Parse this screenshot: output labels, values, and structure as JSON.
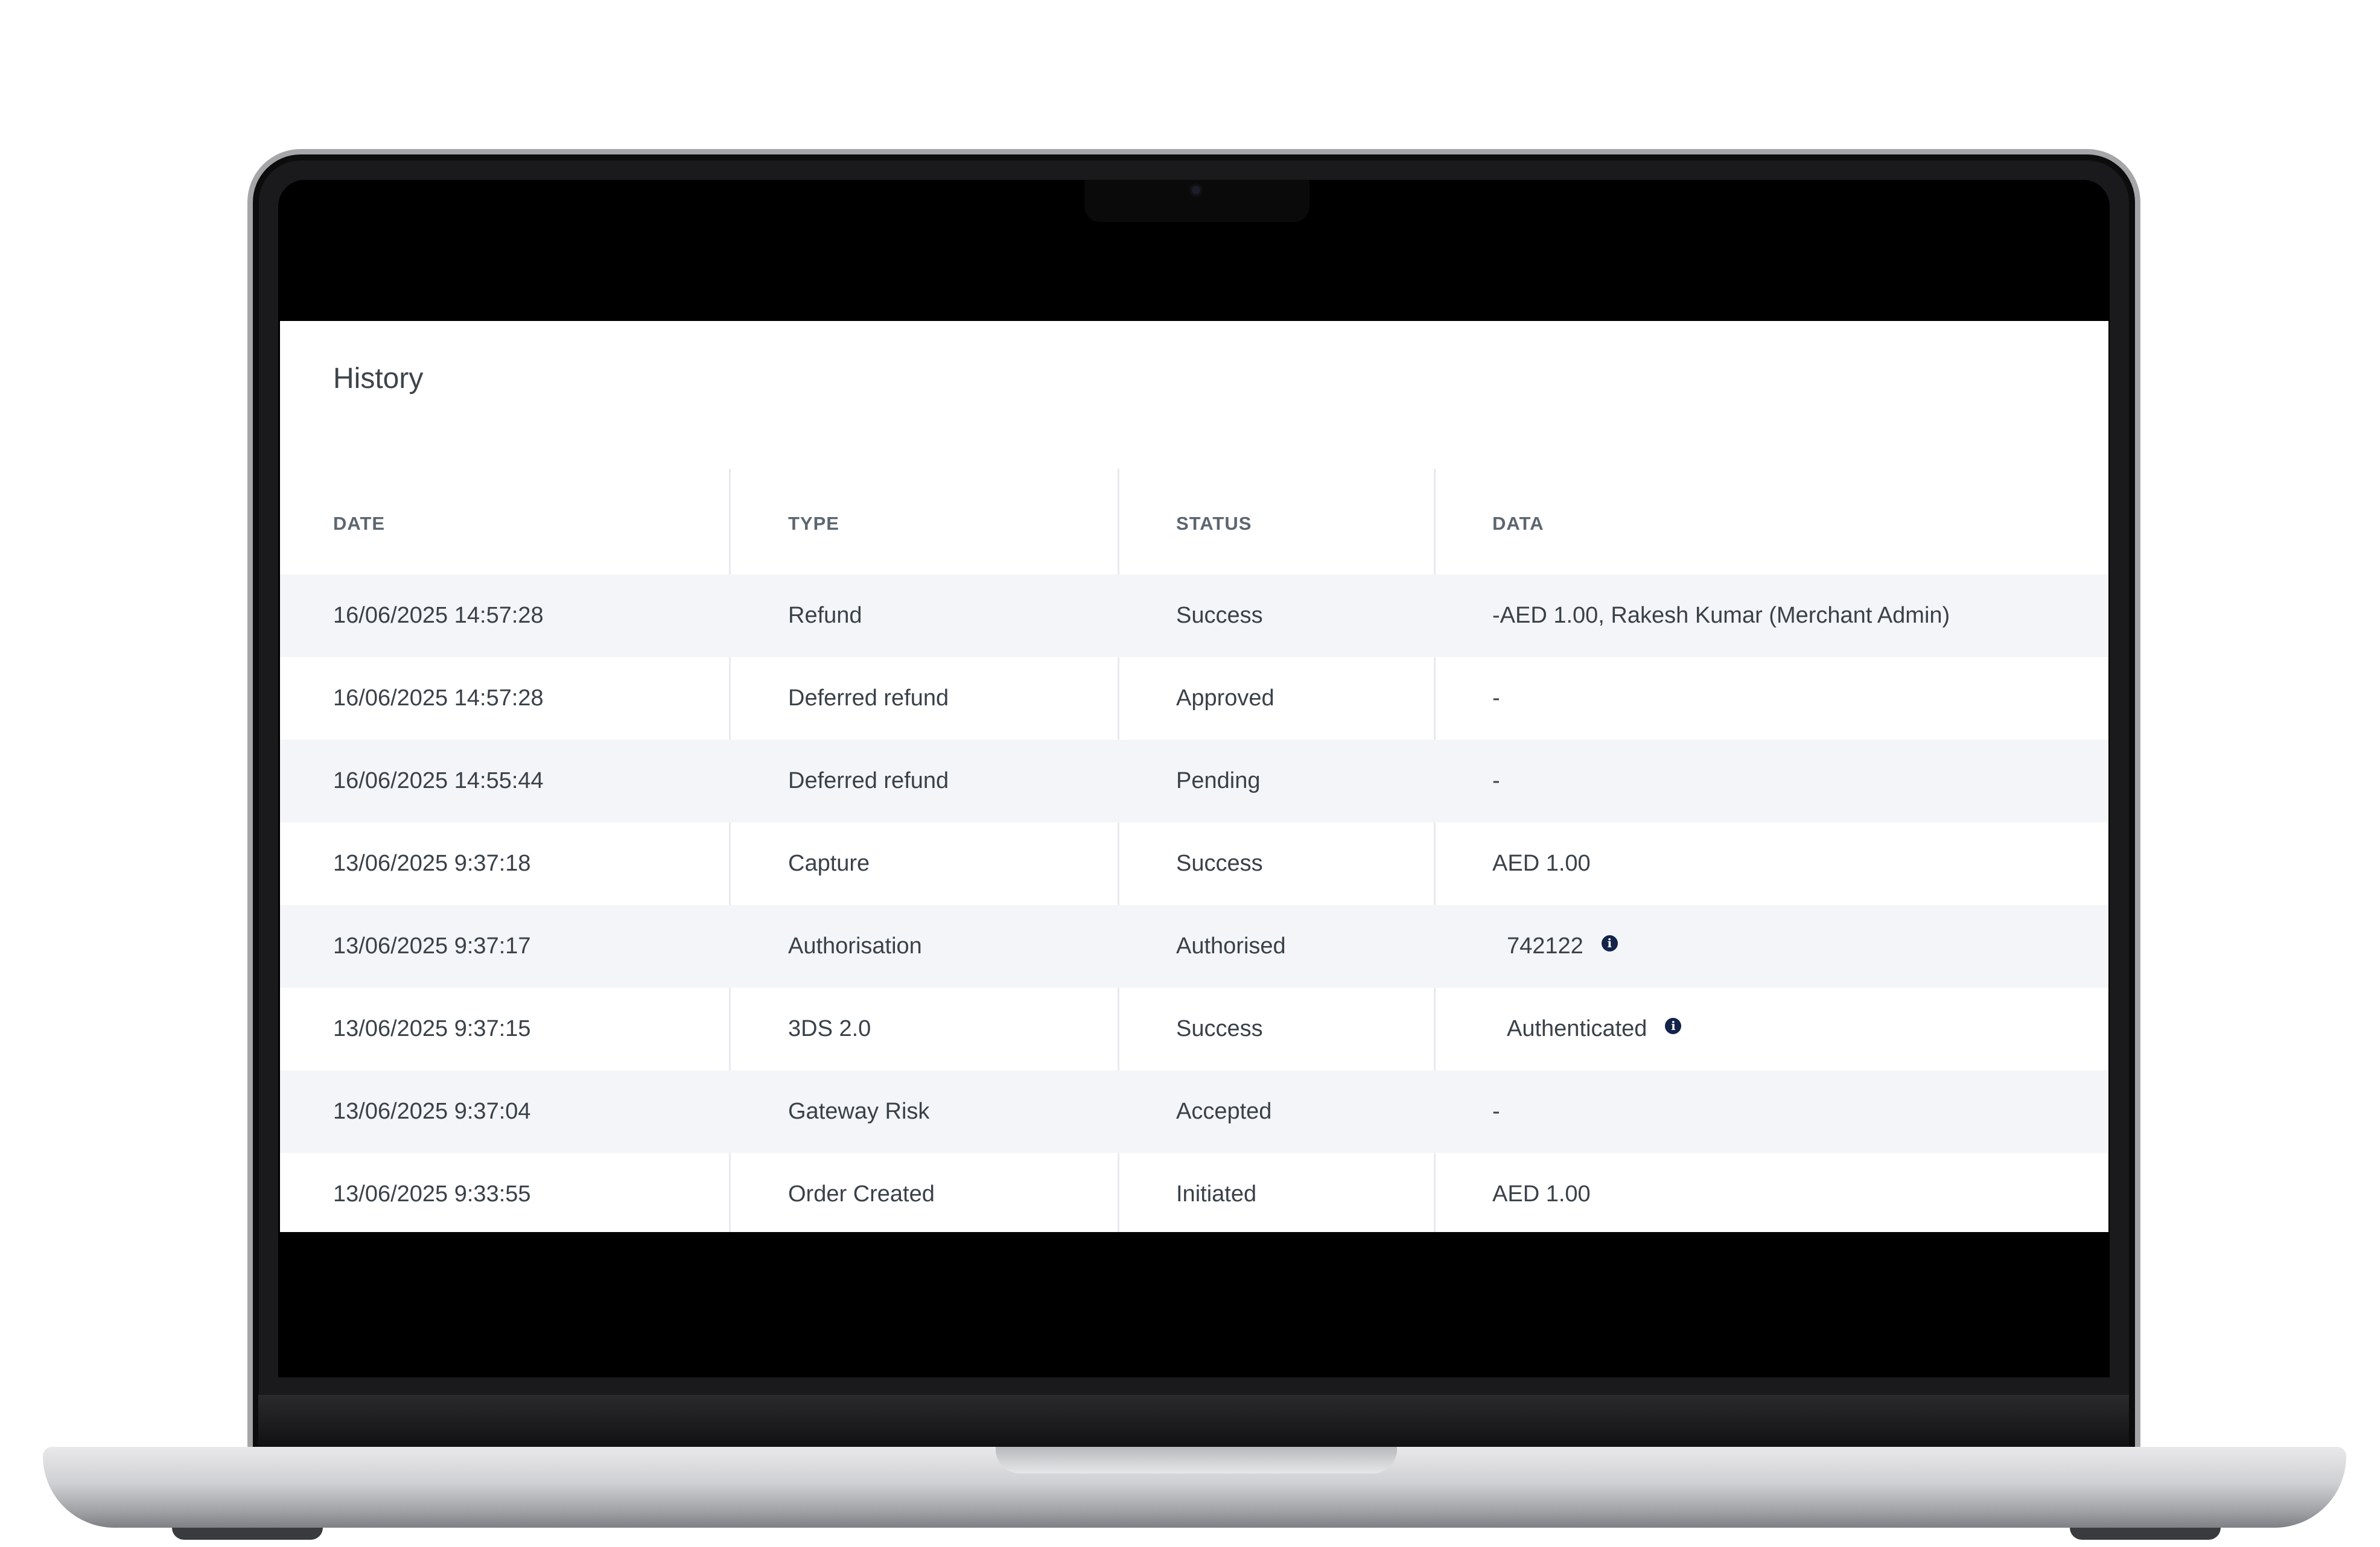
{
  "page": {
    "title": "History"
  },
  "table": {
    "columns": [
      "DATE",
      "TYPE",
      "STATUS",
      "DATA"
    ],
    "rows": [
      {
        "date": "16/06/2025 14:57:28",
        "type": "Refund",
        "status": "Success",
        "data": "-AED 1.00, Rakesh Kumar (Merchant Admin)",
        "has_info": false
      },
      {
        "date": "16/06/2025 14:57:28",
        "type": "Deferred refund",
        "status": "Approved",
        "data": "-",
        "has_info": false
      },
      {
        "date": "16/06/2025 14:55:44",
        "type": "Deferred refund",
        "status": "Pending",
        "data": "-",
        "has_info": false
      },
      {
        "date": "13/06/2025 9:37:18",
        "type": "Capture",
        "status": "Success",
        "data": "AED 1.00",
        "has_info": false
      },
      {
        "date": "13/06/2025 9:37:17",
        "type": "Authorisation",
        "status": "Authorised",
        "data": "742122",
        "has_info": true
      },
      {
        "date": "13/06/2025 9:37:15",
        "type": "3DS 2.0",
        "status": "Success",
        "data": "Authenticated",
        "has_info": true
      },
      {
        "date": "13/06/2025 9:37:04",
        "type": "Gateway Risk",
        "status": "Accepted",
        "data": "-",
        "has_info": false
      },
      {
        "date": "13/06/2025 9:33:55",
        "type": "Order Created",
        "status": "Initiated",
        "data": "AED 1.00",
        "has_info": false
      }
    ]
  },
  "icons": {
    "info": "info-icon",
    "info_glyph": "i"
  },
  "colors": {
    "row_alt_bg": "#f4f5f8",
    "header_text": "#5c6670",
    "body_text": "#3a4148",
    "info_icon_bg": "#13234a"
  }
}
